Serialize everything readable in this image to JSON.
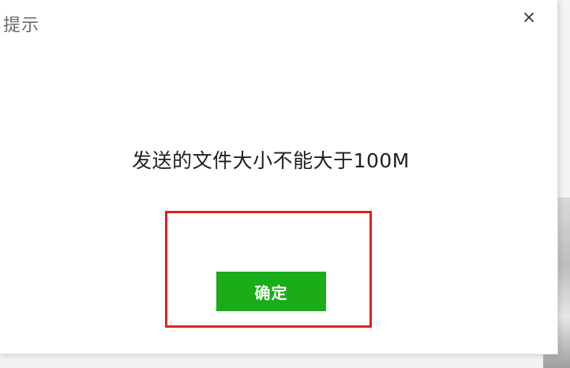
{
  "dialog": {
    "title": "提示",
    "message": "发送的文件大小不能大于100M",
    "ok_label": "确定",
    "close_icon": "close-icon"
  },
  "colors": {
    "primary_button": "#1aad19",
    "highlight_border": "#e02020"
  }
}
